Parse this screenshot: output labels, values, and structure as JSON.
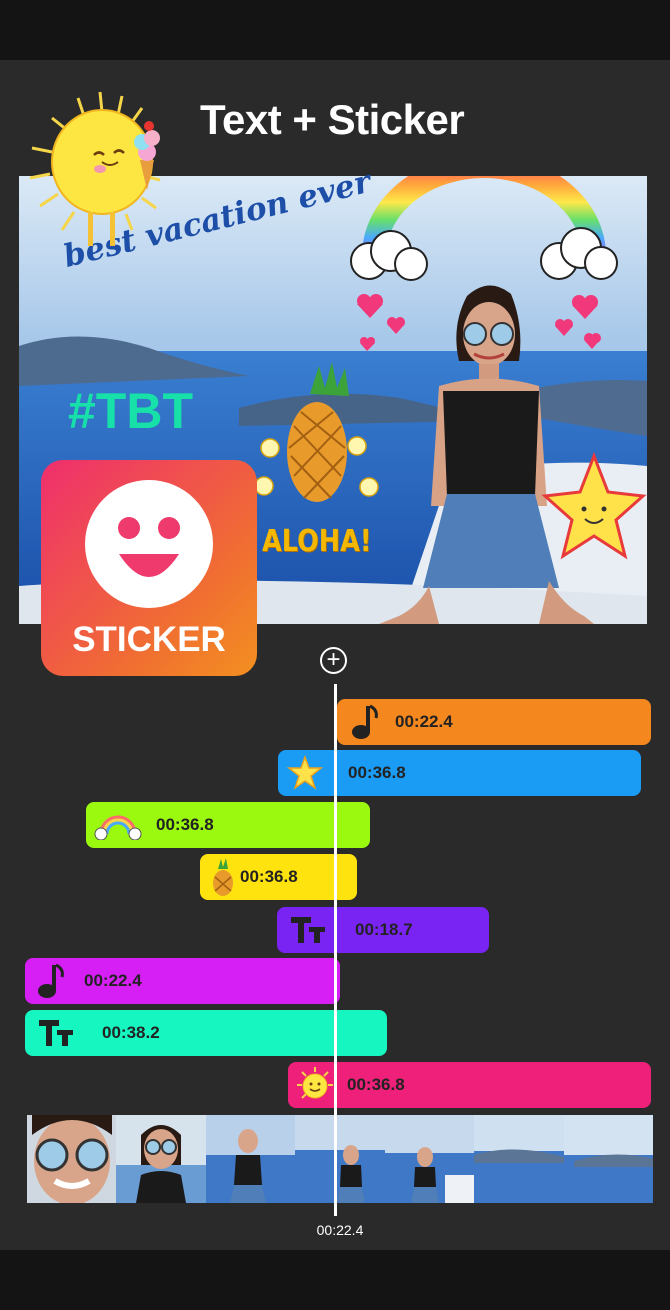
{
  "header": {
    "title": "Text + Sticker"
  },
  "stickers": {
    "caption": "best vacation ever",
    "hashtag": "#TBT",
    "aloha": "ALOHA!",
    "app_badge_label": "STICKER"
  },
  "timeline": {
    "add_icon": "plus-circle-icon",
    "current_time": "00:22.4",
    "tracks": [
      {
        "kind": "music",
        "icon": "music-note-icon",
        "time": "00:22.4",
        "color": "#f4881e"
      },
      {
        "kind": "sticker",
        "icon": "star-sticker-icon",
        "time": "00:36.8",
        "color": "#1a9cf5"
      },
      {
        "kind": "sticker",
        "icon": "rainbow-sticker-icon",
        "time": "00:36.8",
        "color": "#9bf80f"
      },
      {
        "kind": "sticker",
        "icon": "pineapple-sticker-icon",
        "time": "00:36.8",
        "color": "#ffe30e"
      },
      {
        "kind": "text",
        "icon": "text-icon",
        "time": "00:18.7",
        "color": "#7a24f4"
      },
      {
        "kind": "music",
        "icon": "music-note-icon",
        "time": "00:22.4",
        "color": "#d61ff4"
      },
      {
        "kind": "text",
        "icon": "text-icon",
        "time": "00:38.2",
        "color": "#16f6c0"
      },
      {
        "kind": "sticker",
        "icon": "sun-sticker-icon",
        "time": "00:36.8",
        "color": "#ee207a"
      }
    ]
  },
  "colors": {
    "background": "#2a2a2a",
    "badge_start": "#ef2e6e",
    "badge_end": "#f39020"
  }
}
